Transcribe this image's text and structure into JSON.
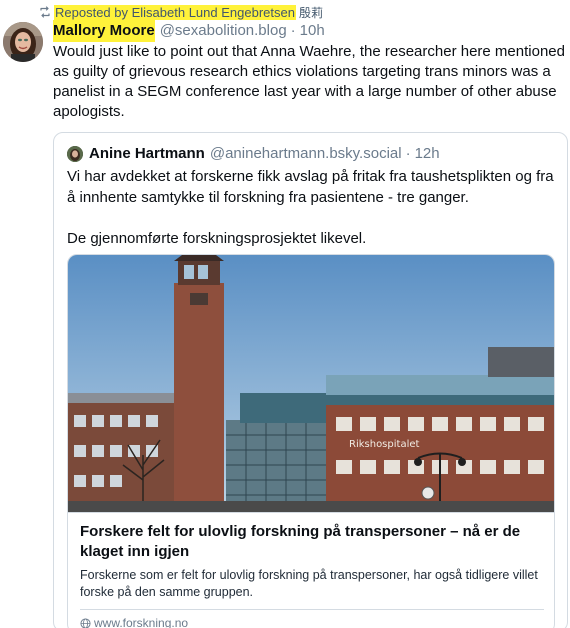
{
  "repost": {
    "icon": "repost-icon",
    "text": "Reposted by Elisabeth Lund Engebretsen",
    "extra": "殷莉"
  },
  "post": {
    "author_name": "Mallory Moore",
    "handle": "@sexabolition.blog",
    "separator": "·",
    "time": "10h",
    "text": "Would just like to point out that Anna Waehre, the researcher here mentioned as guilty of grievous research ethics violations targeting trans minors was a panelist in a SEGM conference last year with a large number of other abuse apologists."
  },
  "quote": {
    "author_name": "Anine Hartmann",
    "handle": "@aninehartmann.bsky.social",
    "separator": "·",
    "time": "12h",
    "paragraph1": "Vi har avdekket at forskerne fikk avslag på fritak fra taushetsplikten og fra å innhente samtykke til forskning fra pasientene - tre ganger.",
    "paragraph2": "De gjennomførte forskningsprosjektet likevel.",
    "card": {
      "image_sign": "Rikshospitalet",
      "title": "Forskere felt for ulovlig forskning på transpersoner – nå er de klaget inn igjen",
      "description": "Forskerne som er felt for ulovlig forskning på transpersoner, har også tidligere villet forske på den samme gruppen.",
      "domain": "www.forskning.no"
    }
  },
  "colors": {
    "highlight": "#fff23a",
    "muted": "#6b7b8c",
    "border": "#d4dbe2",
    "text": "#0b0f14"
  }
}
